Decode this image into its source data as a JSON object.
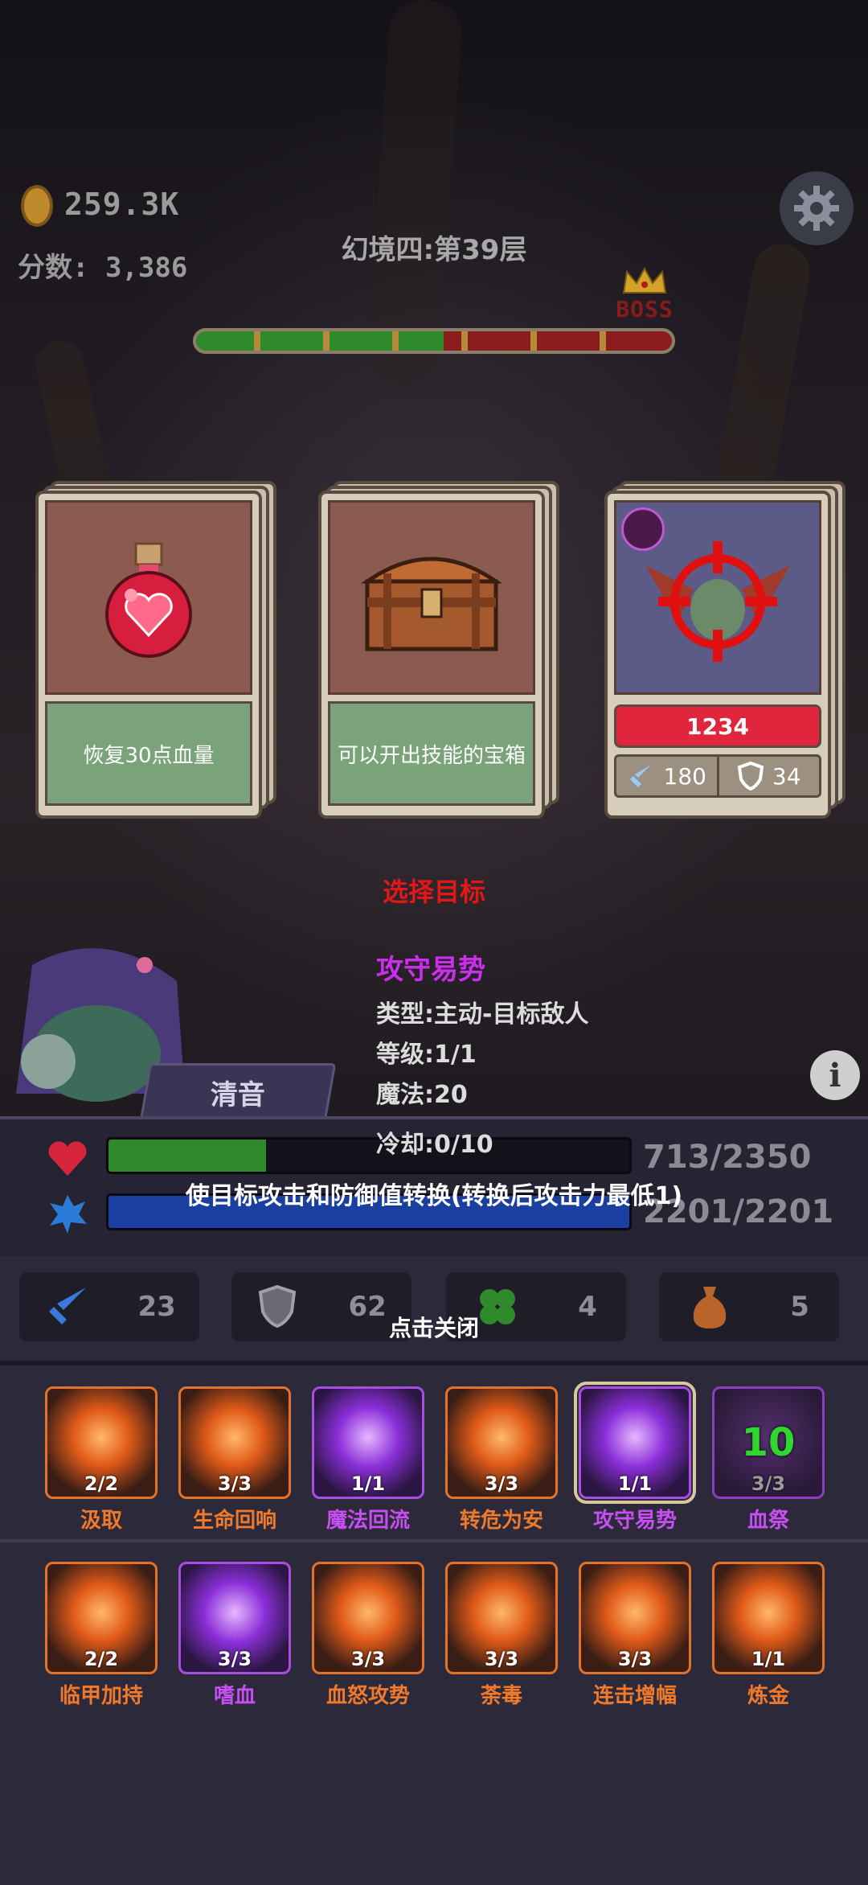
{
  "hud": {
    "gold": "259.3K",
    "score": "分数: 3,386",
    "level_title": "幻境四:第39层",
    "boss_label": "BOSS",
    "progress": {
      "cleared_fraction": 0.52
    }
  },
  "cards": [
    {
      "id": "potion",
      "icon": "red-heart-potion-icon",
      "desc": "恢复30点血量"
    },
    {
      "id": "chest",
      "icon": "treasure-chest-icon",
      "desc": "可以开出技能的宝箱"
    },
    {
      "id": "enemy",
      "icon": "bat-demon-icon",
      "hp": "1234",
      "attack": "180",
      "defense": "34"
    }
  ],
  "popup": {
    "select_target": "选择目标",
    "skill_name": "攻守易势",
    "type": "类型:主动-目标敌人",
    "level": "等级:1/1",
    "mana": "魔法:20",
    "cooldown": "冷却:0/10",
    "description": "使目标攻击和防御值转换(转换后攻击力最低1)",
    "close_hint": "点击关闭"
  },
  "mute_label": "清音",
  "player": {
    "hp_text": "713/2350",
    "hp_fraction": 0.303,
    "mp_text": "2201/2201",
    "mp_fraction": 1.0,
    "stats": {
      "attack": "23",
      "defense": "62",
      "luck": "4",
      "bag": "5"
    }
  },
  "skills_row1": [
    {
      "name": "汲取",
      "count": "2/2",
      "color": "orange"
    },
    {
      "name": "生命回响",
      "count": "3/3",
      "color": "orange"
    },
    {
      "name": "魔法回流",
      "count": "1/1",
      "color": "purple"
    },
    {
      "name": "转危为安",
      "count": "3/3",
      "color": "orange"
    },
    {
      "name": "攻守易势",
      "count": "1/1",
      "color": "purple"
    },
    {
      "name": "血祭",
      "count": "3/3",
      "color": "purple",
      "cooldown": "10"
    }
  ],
  "skills_row2": [
    {
      "name": "临甲加持",
      "count": "2/2",
      "color": "orange"
    },
    {
      "name": "嗜血",
      "count": "3/3",
      "color": "purple"
    },
    {
      "name": "血怒攻势",
      "count": "3/3",
      "color": "orange"
    },
    {
      "name": "荼毒",
      "count": "3/3",
      "color": "orange"
    },
    {
      "name": "连击增幅",
      "count": "3/3",
      "color": "orange"
    },
    {
      "name": "炼金",
      "count": "1/1",
      "color": "orange"
    }
  ],
  "colors": {
    "hp": "#2e8a2a",
    "mp": "#1a3fa0",
    "accent_red": "#e01818",
    "accent_purple": "#cc2ef0"
  }
}
